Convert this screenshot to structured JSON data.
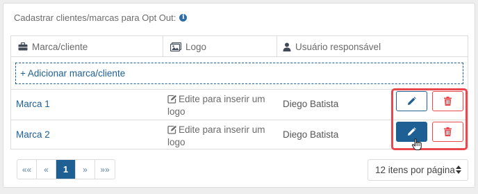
{
  "panel": {
    "title": "Cadastrar clientes/marcas para Opt Out:",
    "info_icon": "info-circle-icon"
  },
  "table": {
    "headers": [
      {
        "label": "Marca/cliente",
        "icon": "briefcase-icon"
      },
      {
        "label": "Logo",
        "icon": "images-icon"
      },
      {
        "label": "Usuário responsável",
        "icon": "user-icon"
      }
    ],
    "add_label": "+ Adicionar marca/cliente",
    "rows": [
      {
        "name": "Marca 1",
        "logo_text": "Edite para inserir um logo",
        "user": "Diego Batista",
        "edit_active": false
      },
      {
        "name": "Marca 2",
        "logo_text": "Edite para inserir um logo",
        "user": "Diego Batista",
        "edit_active": true
      }
    ]
  },
  "pagination": {
    "first": "««",
    "prev": "«",
    "current": "1",
    "next": "»",
    "last": "»»"
  },
  "per_page": {
    "selected": "12 itens por página"
  },
  "colors": {
    "primary": "#1e5f94",
    "danger": "#e8474c",
    "highlight": "#e8474c"
  }
}
